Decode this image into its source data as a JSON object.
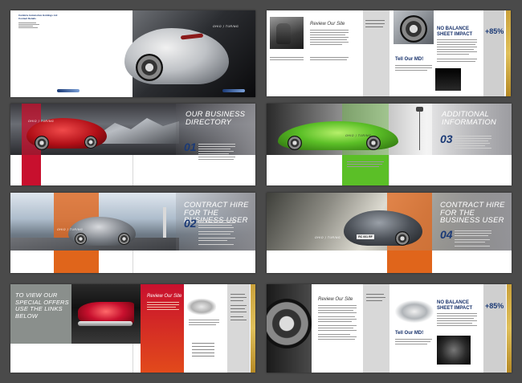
{
  "spread1": {
    "company_lines": [
      "Cambria Automotive Holdings Ltd",
      "Contact Details"
    ]
  },
  "spread2": {
    "review_title": "Review Our Site",
    "no_balance_title": "NO BALANCE SHEET IMPACT",
    "percent": "+85%",
    "tell_title": "Tell Our MD!"
  },
  "spread3": {
    "heading": "OUR BUSINESS DIRECTORY",
    "number": "01"
  },
  "spread4": {
    "heading": "ADDITIONAL INFORMATION",
    "number": "03",
    "plate": ""
  },
  "spread5": {
    "heading": "CONTRACT HIRE FOR THE BUSINESS USER",
    "number": "02"
  },
  "spread6": {
    "heading": "CONTRACT HIRE FOR THE BUSINESS USER",
    "number": "04",
    "plate": "RC 001 RF"
  },
  "spread7": {
    "offers": "TO VIEW OUR SPECIAL OFFERS USE THE LINKS BELOW",
    "review_title": "Review Our Site"
  },
  "spread8": {
    "review_title": "Review Our Site",
    "percent": "+85%",
    "no_balance_title": "NO BALANCE SHEET IMPACT",
    "tell_title": "Tell Our MD!"
  },
  "colors": {
    "background": "#4a4a4a",
    "navy": "#1b3a76",
    "red": "#c8102e",
    "orange": "#e0651b",
    "green": "#5bbf27",
    "gold": "#caa13a"
  }
}
